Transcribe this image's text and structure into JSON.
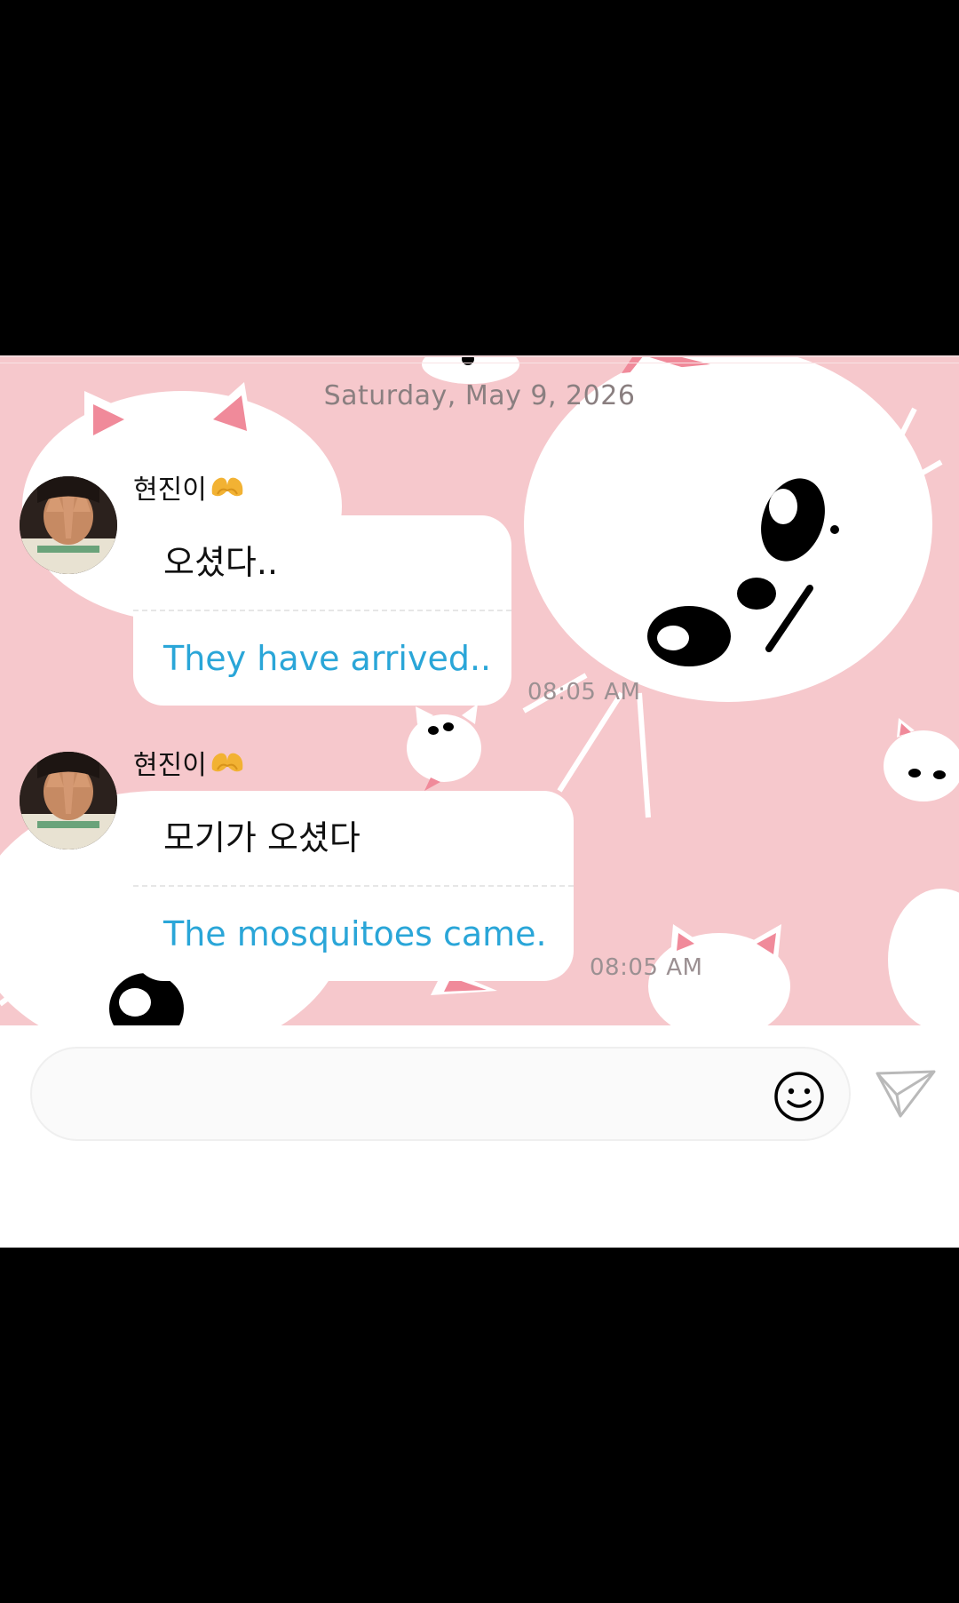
{
  "chat": {
    "date_separator": "Saturday, May 9, 2026",
    "messages": [
      {
        "sender": "현진이🫶",
        "sender_name": "현진이",
        "original": "오셨다..",
        "translation": "They have arrived..",
        "time": "08:05 AM"
      },
      {
        "sender": "현진이🫶",
        "sender_name": "현진이",
        "original": "모기가 오셨다",
        "translation": "The mosquitoes came.",
        "time": "08:05 AM"
      }
    ]
  },
  "composer": {
    "value": "",
    "placeholder": "",
    "emoji_icon": "smiley-icon",
    "send_icon": "paper-plane-icon"
  },
  "colors": {
    "wallpaper_pink": "#f6c8cc",
    "translation_text": "#2aa6d8",
    "bubble": "#ffffff",
    "timestamp": "#9b9092"
  }
}
